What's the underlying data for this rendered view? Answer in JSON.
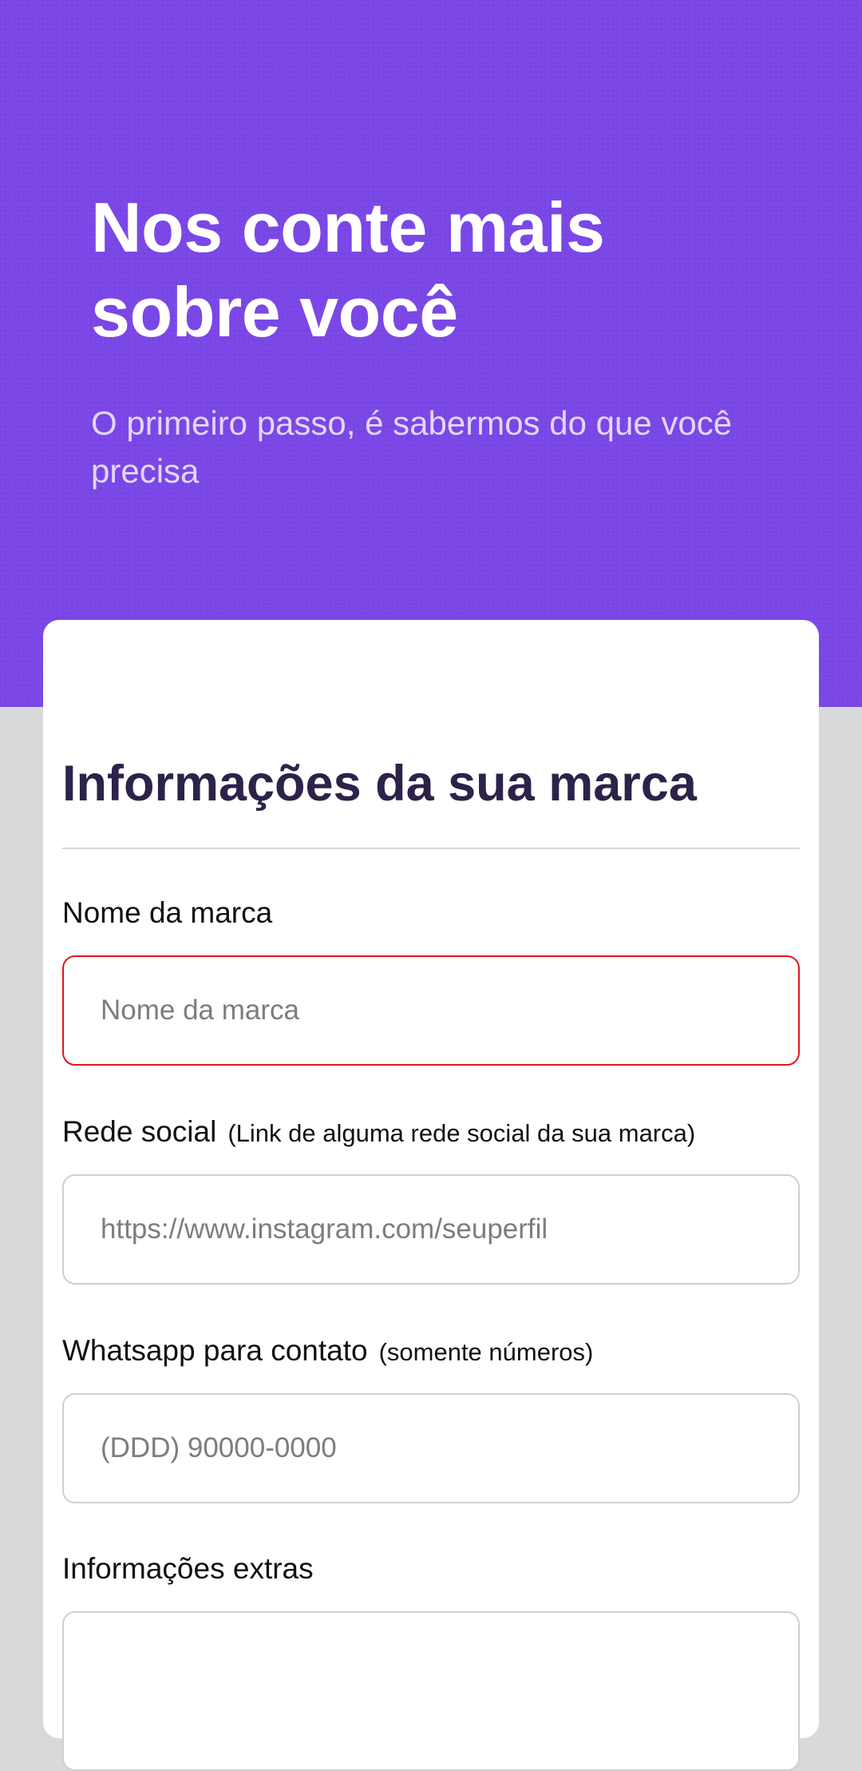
{
  "hero": {
    "title": "Nos conte mais sobre você",
    "subtitle": "O primeiro passo, é sabermos do que você precisa"
  },
  "form": {
    "section_title": "Informações da sua marca",
    "fields": {
      "brand_name": {
        "label": "Nome da marca",
        "placeholder": "Nome da marca",
        "value": "",
        "state": "error"
      },
      "social": {
        "label": "Rede social",
        "hint": "(Link de alguma rede social da sua marca)",
        "placeholder": "https://www.instagram.com/seuperfil",
        "value": ""
      },
      "whatsapp": {
        "label": "Whatsapp para contato",
        "hint": "(somente números)",
        "placeholder": "(DDD) 90000-0000",
        "value": ""
      },
      "extra": {
        "label": "Informações extras",
        "value": ""
      }
    }
  },
  "colors": {
    "hero_background": "#7a47e6",
    "page_background": "#d9d9d9",
    "section_title": "#2d2249",
    "error_border": "#e0161e"
  }
}
